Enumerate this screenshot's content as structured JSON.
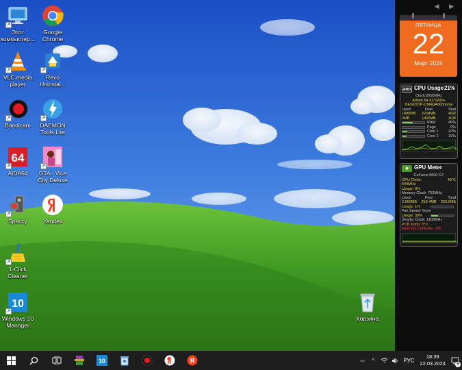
{
  "desktop": {
    "icons": [
      {
        "label": "Этот компьютер..."
      },
      {
        "label": "Google Chrome"
      },
      {
        "label": "VLC media player"
      },
      {
        "label": "Revo Uninstal..."
      },
      {
        "label": "Bandicam"
      },
      {
        "label": "DAEMON Tools Lite"
      },
      {
        "label": "AIDA64"
      },
      {
        "label": "GTA - Vice City Deluxe"
      },
      {
        "label": "Speccy"
      },
      {
        "label": "Yandex"
      },
      {
        "label": "1-Click Cleaner"
      },
      {
        "label": "Windows 10 Manager"
      },
      {
        "label": "Корзина"
      }
    ]
  },
  "calendar": {
    "weekday": "ПЯТНИЦА",
    "day": "22",
    "month_year": "Март 2024",
    "color": "#ef6b20"
  },
  "cpu_gadget": {
    "title": "CPU Usage",
    "percent": "21%",
    "clock": "Clock:2600MHz",
    "model": "Athlon 64 X2 5200+",
    "host": "DESKTOP-CM4QA8Q\\home",
    "mem_header": [
      "Used",
      "Free",
      "Total"
    ],
    "mem_row1": [
      "1890MB",
      "2204MB",
      "4GB"
    ],
    "mem_row2": [
      "2MB",
      "1406MB",
      "1GB"
    ],
    "ram_label": "RAM",
    "ram_value": "46%",
    "ram_fill": 0.46,
    "page_label": "Page",
    "page_value": "0%",
    "page_fill": 0.0,
    "core1_label": "Core 1",
    "core1_value": "22%",
    "core1_fill": 0.22,
    "core2_label": "Core 2",
    "core2_value": "19%",
    "core2_fill": 0.19
  },
  "gpu_gadget": {
    "title": "GPU Meter",
    "model": "GeForce 8600 GT",
    "gpu_clock": "GPU Clock: 540MHz",
    "temp": "48°C",
    "usage": "Usage: 0%",
    "mem_clock": "Memory Clock: 702MHz",
    "mem_header": [
      "Used",
      "Free",
      "Total"
    ],
    "mem_row": [
      "2.560MB",
      "253.4MB",
      "256.0MB"
    ],
    "mem_usage": "Usage: 1%",
    "mem_fill": 0.01,
    "fan": "Fan Speed: 0rpm",
    "fan_usage": "Usage: 30%",
    "fan_fill": 0.3,
    "shader": "Shader Clock: 1188MHz",
    "pcb": "PCB Temp: 0°C",
    "mem_ctrl": "Mem my Controller: 0%"
  },
  "taskbar": {
    "icons": [
      "windows-start",
      "search",
      "task-view",
      "winrar",
      "windows10-manager",
      "revo-uninstaller",
      "bandicam",
      "yandex-browser",
      "yandex-app"
    ],
    "language": "РУС",
    "time": "18:39",
    "date": "22.03.2024",
    "notification_count": "6"
  },
  "colors": {
    "sky": "#2f6fd8",
    "grass": "#3f9a22",
    "taskbar": "#1e1e1e",
    "sidebar": "#0d0d0d"
  }
}
